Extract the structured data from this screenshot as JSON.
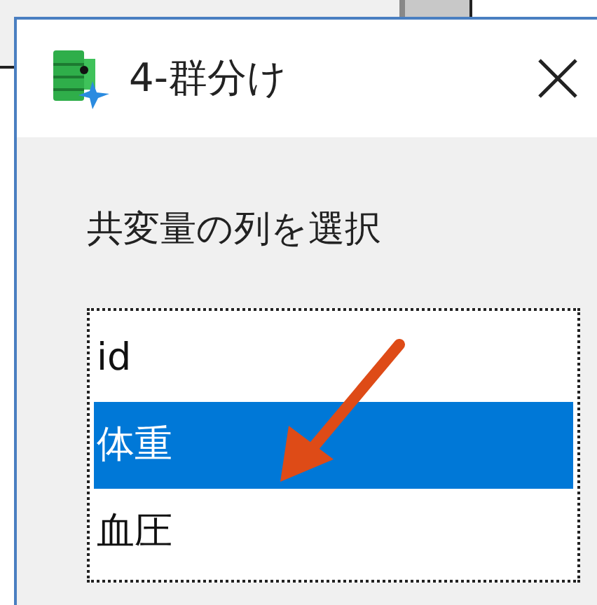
{
  "dialog": {
    "title": "4-群分け",
    "prompt": "共変量の列を選択"
  },
  "list": {
    "items": [
      {
        "label": "id",
        "selected": false
      },
      {
        "label": "体重",
        "selected": true
      },
      {
        "label": "血圧",
        "selected": false
      }
    ]
  }
}
